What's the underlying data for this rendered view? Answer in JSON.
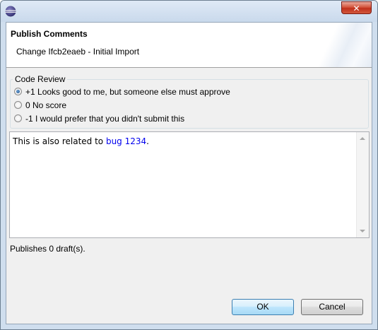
{
  "window": {
    "close_label": "✕"
  },
  "header": {
    "title": "Publish Comments",
    "message": "Change Ifcb2eaeb - Initial Import"
  },
  "review": {
    "group_label": "Code Review",
    "options": [
      {
        "label": "+1 Looks good to me, but someone else must approve",
        "selected": true
      },
      {
        "label": "0 No score",
        "selected": false
      },
      {
        "label": "-1 I would prefer that you didn't submit this",
        "selected": false
      }
    ]
  },
  "comment": {
    "text_before": "This is also related to ",
    "link_text": "bug 1234",
    "text_after": "."
  },
  "status": "Publishes 0 draft(s).",
  "buttons": {
    "ok": "OK",
    "cancel": "Cancel"
  }
}
